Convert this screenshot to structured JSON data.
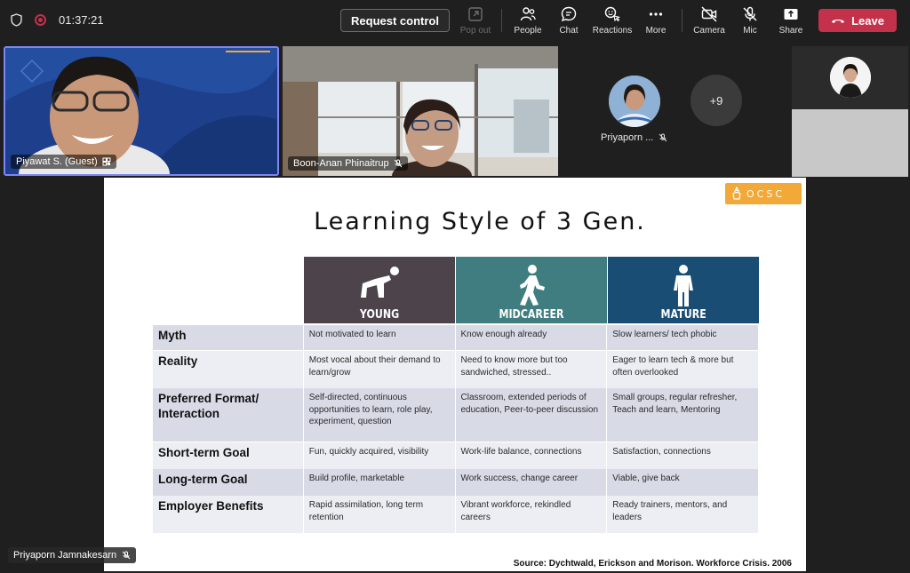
{
  "meeting": {
    "timer": "01:37:21",
    "request_control": "Request control",
    "toolbar": [
      {
        "label": "Pop out",
        "icon": "pop-out-icon",
        "disabled": true
      },
      {
        "label": "People",
        "icon": "people-icon"
      },
      {
        "label": "Chat",
        "icon": "chat-icon"
      },
      {
        "label": "Reactions",
        "icon": "reactions-icon"
      },
      {
        "label": "More",
        "icon": "more-icon"
      },
      {
        "label": "Camera",
        "icon": "camera-off-icon"
      },
      {
        "label": "Mic",
        "icon": "mic-off-icon"
      },
      {
        "label": "Share",
        "icon": "share-icon"
      }
    ],
    "leave": "Leave",
    "colors": {
      "leave": "#c4314b",
      "active_speaker": "#7f85f5"
    }
  },
  "participants": {
    "tile1_name": "Piyawat S. (Guest)",
    "tile2_name": "Boon-Anan Phinaitrup",
    "avatar_name": "Priyaporn ...",
    "overflow": "+9",
    "presenter": "Priyaporn Jamnakesarn"
  },
  "slide": {
    "logo": "OCSC",
    "title": "Learning Style of 3 Gen.",
    "columns": [
      "YOUNG",
      "MIDCAREER",
      "MATURE"
    ],
    "rows": [
      {
        "category": "Myth",
        "young": "Not motivated to learn",
        "mid": "Know enough already",
        "mature": "Slow learners/ tech phobic"
      },
      {
        "category": "Reality",
        "young": "Most vocal about their demand to learn/grow",
        "mid": "Need to know more but too sandwiched, stressed..",
        "mature": "Eager to learn tech & more but often overlooked"
      },
      {
        "category": "Preferred Format/ Interaction",
        "young": "Self-directed, continuous opportunities to learn, role play, experiment, question",
        "mid": "Classroom, extended periods of education, Peer-to-peer discussion",
        "mature": "Small groups, regular refresher, Teach and learn, Mentoring"
      },
      {
        "category": "Short-term Goal",
        "young": "Fun, quickly acquired, visibility",
        "mid": "Work-life balance, connections",
        "mature": "Satisfaction, connections"
      },
      {
        "category": "Long-term Goal",
        "young": "Build profile, marketable",
        "mid": "Work success, change career",
        "mature": "Viable, give back"
      },
      {
        "category": "Employer Benefits",
        "young": "Rapid assimilation, long term retention",
        "mid": "Vibrant workforce, rekindled careers",
        "mature": "Ready trainers, mentors, and leaders"
      }
    ],
    "source": "Source: Dychtwald, Erickson and Morison. Workforce Crisis. 2006"
  }
}
